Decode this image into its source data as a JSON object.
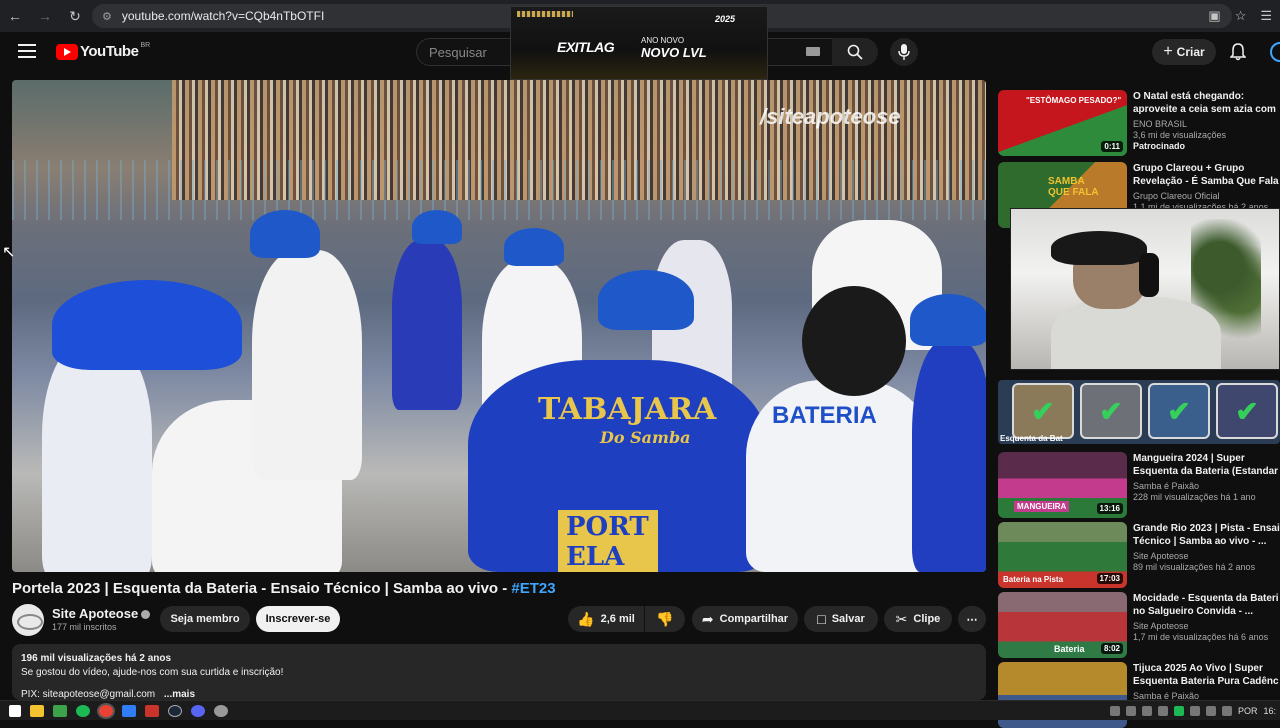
{
  "browser": {
    "url": "youtube.com/watch?v=CQb4nTbOTFI",
    "back_icon": "arrow-left-icon",
    "forward_icon": "arrow-right-icon",
    "reload_icon": "reload-icon"
  },
  "header": {
    "logo_text": "YouTube",
    "country_code": "BR",
    "search_placeholder": "Pesquisar",
    "create_label": "Criar"
  },
  "ad_banner": {
    "brand": "EXITLAG",
    "line1": "ANO NOVO",
    "line2": "NOVO LVL",
    "year": "2025"
  },
  "video": {
    "watermark": "/siteapoteose",
    "shirt_text_1": "TABAJARA",
    "shirt_text_2": "Do Samba",
    "shirt_text_3": "PORTELA",
    "shirt_text_4": "BATERIA",
    "title": "Portela 2023 | Esquenta da Bateria - Ensaio Técnico | Samba ao vivo - ",
    "hashtag": "#ET23",
    "channel_name": "Site Apoteose",
    "subscribers": "177 mil inscritos",
    "join_label": "Seja membro",
    "subscribe_label": "Inscrever-se",
    "like_count": "2,6 mil",
    "share_label": "Compartilhar",
    "save_label": "Salvar",
    "clip_label": "Clipe",
    "views_meta": "196 mil visualizações  há 2 anos",
    "description_line1": "Se gostou do vídeo, ajude-nos com sua curtida e inscrição!",
    "description_line2": "PIX: siteapoteose@gmail.com",
    "more_label": "...mais"
  },
  "recommendations": [
    {
      "title1": "O Natal está chegando:",
      "title2": "aproveite a ceia sem azia com",
      "channel": "ENO BRASIL",
      "meta": "3,6 mi de visualizações",
      "extra": "Patrocinado",
      "duration": "0:11",
      "thumb_text": "\"ESTÔMAGO PESADO?\"",
      "color1": "#c4161c",
      "color2": "#f6c342"
    },
    {
      "title1": "Grupo Clareou + Grupo",
      "title2": "Revelação - É Samba Que Fala",
      "channel": "Grupo Clareou Oficial",
      "meta": "1,1 mi de visualizações  há 2 anos",
      "extra": "",
      "duration": "",
      "thumb_text": "SAMBA QUE FALA",
      "color1": "#2f6b2c",
      "color2": "#f2c230"
    },
    {
      "title1": "Mangueira 2024 | Super",
      "title2": "Esquenta da Bateria (Estandar",
      "channel": "Samba é Paixão",
      "meta": "228 mil visualizações  há 1 ano",
      "extra": "",
      "duration": "13:16",
      "thumb_text": "MANGUEIRA",
      "color1": "#c33b8c",
      "color2": "#2c7a3a"
    },
    {
      "title1": "Grande Rio 2023 | Pista - Ensai",
      "title2": "Técnico | Samba ao vivo - ...",
      "channel": "Site Apoteose",
      "meta": "89 mil visualizações  há 2 anos",
      "extra": "",
      "duration": "17:03",
      "thumb_text": "Bateria na Pista",
      "color1": "#2f7a3b",
      "color2": "#c9342c"
    },
    {
      "title1": "Mocidade - Esquenta da Bateri",
      "title2": "no Salgueiro Convida - ...",
      "channel": "Site Apoteose",
      "meta": "1,7 mi de visualizações  há 6 anos",
      "extra": "",
      "duration": "8:02",
      "thumb_text": "Bateria",
      "color1": "#b8363a",
      "color2": "#2f7a45"
    },
    {
      "title1": "Tijuca 2025 Ao Vivo | Super",
      "title2": "Esquenta Bateria Pura Cadênc",
      "channel": "Samba é Paixão",
      "meta": "",
      "extra": "",
      "duration": "",
      "thumb_text": "",
      "color1": "#b48a2c",
      "color2": "#3f5a8a"
    }
  ],
  "gallery_label": "Esquenta da Bat",
  "taskbar": {
    "language": "POR",
    "clock": "16:"
  }
}
